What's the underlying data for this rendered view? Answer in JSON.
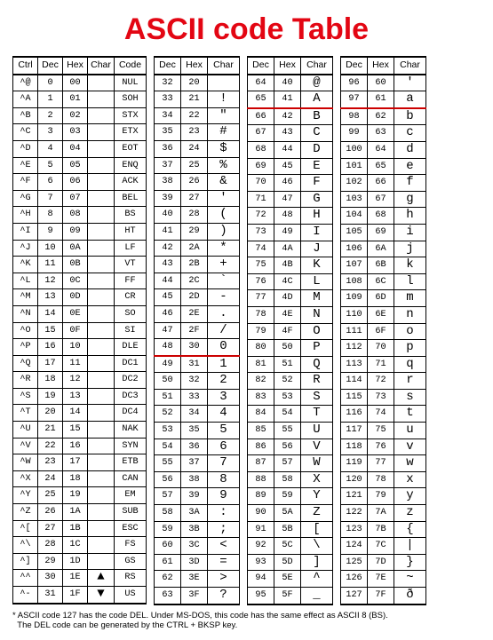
{
  "title": "ASCII code Table",
  "headers": {
    "ctrl": "Ctrl",
    "dec": "Dec",
    "hex": "Hex",
    "char": "Char",
    "code": "Code"
  },
  "panel1": [
    {
      "ctrl": "^@",
      "dec": 0,
      "hex": "00",
      "char": "",
      "code": "NUL"
    },
    {
      "ctrl": "^A",
      "dec": 1,
      "hex": "01",
      "char": "",
      "code": "SOH"
    },
    {
      "ctrl": "^B",
      "dec": 2,
      "hex": "02",
      "char": "",
      "code": "STX"
    },
    {
      "ctrl": "^C",
      "dec": 3,
      "hex": "03",
      "char": "",
      "code": "ETX"
    },
    {
      "ctrl": "^D",
      "dec": 4,
      "hex": "04",
      "char": "",
      "code": "EOT"
    },
    {
      "ctrl": "^E",
      "dec": 5,
      "hex": "05",
      "char": "",
      "code": "ENQ"
    },
    {
      "ctrl": "^F",
      "dec": 6,
      "hex": "06",
      "char": "",
      "code": "ACK"
    },
    {
      "ctrl": "^G",
      "dec": 7,
      "hex": "07",
      "char": "",
      "code": "BEL"
    },
    {
      "ctrl": "^H",
      "dec": 8,
      "hex": "08",
      "char": "",
      "code": "BS"
    },
    {
      "ctrl": "^I",
      "dec": 9,
      "hex": "09",
      "char": "",
      "code": "HT"
    },
    {
      "ctrl": "^J",
      "dec": 10,
      "hex": "0A",
      "char": "",
      "code": "LF"
    },
    {
      "ctrl": "^K",
      "dec": 11,
      "hex": "0B",
      "char": "",
      "code": "VT"
    },
    {
      "ctrl": "^L",
      "dec": 12,
      "hex": "0C",
      "char": "",
      "code": "FF"
    },
    {
      "ctrl": "^M",
      "dec": 13,
      "hex": "0D",
      "char": "",
      "code": "CR"
    },
    {
      "ctrl": "^N",
      "dec": 14,
      "hex": "0E",
      "char": "",
      "code": "SO"
    },
    {
      "ctrl": "^O",
      "dec": 15,
      "hex": "0F",
      "char": "",
      "code": "SI"
    },
    {
      "ctrl": "^P",
      "dec": 16,
      "hex": "10",
      "char": "",
      "code": "DLE"
    },
    {
      "ctrl": "^Q",
      "dec": 17,
      "hex": "11",
      "char": "",
      "code": "DC1"
    },
    {
      "ctrl": "^R",
      "dec": 18,
      "hex": "12",
      "char": "",
      "code": "DC2"
    },
    {
      "ctrl": "^S",
      "dec": 19,
      "hex": "13",
      "char": "",
      "code": "DC3"
    },
    {
      "ctrl": "^T",
      "dec": 20,
      "hex": "14",
      "char": "",
      "code": "DC4"
    },
    {
      "ctrl": "^U",
      "dec": 21,
      "hex": "15",
      "char": "",
      "code": "NAK"
    },
    {
      "ctrl": "^V",
      "dec": 22,
      "hex": "16",
      "char": "",
      "code": "SYN"
    },
    {
      "ctrl": "^W",
      "dec": 23,
      "hex": "17",
      "char": "",
      "code": "ETB"
    },
    {
      "ctrl": "^X",
      "dec": 24,
      "hex": "18",
      "char": "",
      "code": "CAN"
    },
    {
      "ctrl": "^Y",
      "dec": 25,
      "hex": "19",
      "char": "",
      "code": "EM"
    },
    {
      "ctrl": "^Z",
      "dec": 26,
      "hex": "1A",
      "char": "",
      "code": "SUB"
    },
    {
      "ctrl": "^[",
      "dec": 27,
      "hex": "1B",
      "char": "",
      "code": "ESC"
    },
    {
      "ctrl": "^\\",
      "dec": 28,
      "hex": "1C",
      "char": "",
      "code": "FS"
    },
    {
      "ctrl": "^]",
      "dec": 29,
      "hex": "1D",
      "char": "",
      "code": "GS"
    },
    {
      "ctrl": "^^",
      "dec": 30,
      "hex": "1E",
      "char": "glyph-up",
      "code": "RS"
    },
    {
      "ctrl": "^-",
      "dec": 31,
      "hex": "1F",
      "char": "glyph-down",
      "code": "US"
    }
  ],
  "panel2": [
    {
      "dec": 32,
      "hex": "20",
      "char": " "
    },
    {
      "dec": 33,
      "hex": "21",
      "char": "!"
    },
    {
      "dec": 34,
      "hex": "22",
      "char": "\""
    },
    {
      "dec": 35,
      "hex": "23",
      "char": "#"
    },
    {
      "dec": 36,
      "hex": "24",
      "char": "$"
    },
    {
      "dec": 37,
      "hex": "25",
      "char": "%"
    },
    {
      "dec": 38,
      "hex": "26",
      "char": "&"
    },
    {
      "dec": 39,
      "hex": "27",
      "char": "'"
    },
    {
      "dec": 40,
      "hex": "28",
      "char": "("
    },
    {
      "dec": 41,
      "hex": "29",
      "char": ")"
    },
    {
      "dec": 42,
      "hex": "2A",
      "char": "*"
    },
    {
      "dec": 43,
      "hex": "2B",
      "char": "+"
    },
    {
      "dec": 44,
      "hex": "2C",
      "char": "`"
    },
    {
      "dec": 45,
      "hex": "2D",
      "char": "-"
    },
    {
      "dec": 46,
      "hex": "2E",
      "char": "."
    },
    {
      "dec": 47,
      "hex": "2F",
      "char": "/"
    },
    {
      "dec": 48,
      "hex": "30",
      "char": "0"
    },
    {
      "dec": 49,
      "hex": "31",
      "char": "1",
      "sep": true
    },
    {
      "dec": 50,
      "hex": "32",
      "char": "2"
    },
    {
      "dec": 51,
      "hex": "33",
      "char": "3"
    },
    {
      "dec": 52,
      "hex": "34",
      "char": "4"
    },
    {
      "dec": 53,
      "hex": "35",
      "char": "5"
    },
    {
      "dec": 54,
      "hex": "36",
      "char": "6"
    },
    {
      "dec": 55,
      "hex": "37",
      "char": "7"
    },
    {
      "dec": 56,
      "hex": "38",
      "char": "8"
    },
    {
      "dec": 57,
      "hex": "39",
      "char": "9"
    },
    {
      "dec": 58,
      "hex": "3A",
      "char": ":"
    },
    {
      "dec": 59,
      "hex": "3B",
      "char": ";"
    },
    {
      "dec": 60,
      "hex": "3C",
      "char": "<"
    },
    {
      "dec": 61,
      "hex": "3D",
      "char": "="
    },
    {
      "dec": 62,
      "hex": "3E",
      "char": ">"
    },
    {
      "dec": 63,
      "hex": "3F",
      "char": "?"
    }
  ],
  "panel3": [
    {
      "dec": 64,
      "hex": "40",
      "char": "@"
    },
    {
      "dec": 65,
      "hex": "41",
      "char": "A"
    },
    {
      "dec": 66,
      "hex": "42",
      "char": "B",
      "sep": true
    },
    {
      "dec": 67,
      "hex": "43",
      "char": "C"
    },
    {
      "dec": 68,
      "hex": "44",
      "char": "D"
    },
    {
      "dec": 69,
      "hex": "45",
      "char": "E"
    },
    {
      "dec": 70,
      "hex": "46",
      "char": "F"
    },
    {
      "dec": 71,
      "hex": "47",
      "char": "G"
    },
    {
      "dec": 72,
      "hex": "48",
      "char": "H"
    },
    {
      "dec": 73,
      "hex": "49",
      "char": "I"
    },
    {
      "dec": 74,
      "hex": "4A",
      "char": "J"
    },
    {
      "dec": 75,
      "hex": "4B",
      "char": "K"
    },
    {
      "dec": 76,
      "hex": "4C",
      "char": "L"
    },
    {
      "dec": 77,
      "hex": "4D",
      "char": "M"
    },
    {
      "dec": 78,
      "hex": "4E",
      "char": "N"
    },
    {
      "dec": 79,
      "hex": "4F",
      "char": "O"
    },
    {
      "dec": 80,
      "hex": "50",
      "char": "P"
    },
    {
      "dec": 81,
      "hex": "51",
      "char": "Q"
    },
    {
      "dec": 82,
      "hex": "52",
      "char": "R"
    },
    {
      "dec": 83,
      "hex": "53",
      "char": "S"
    },
    {
      "dec": 84,
      "hex": "54",
      "char": "T"
    },
    {
      "dec": 85,
      "hex": "55",
      "char": "U"
    },
    {
      "dec": 86,
      "hex": "56",
      "char": "V"
    },
    {
      "dec": 87,
      "hex": "57",
      "char": "W"
    },
    {
      "dec": 88,
      "hex": "58",
      "char": "X"
    },
    {
      "dec": 89,
      "hex": "59",
      "char": "Y"
    },
    {
      "dec": 90,
      "hex": "5A",
      "char": "Z"
    },
    {
      "dec": 91,
      "hex": "5B",
      "char": "["
    },
    {
      "dec": 92,
      "hex": "5C",
      "char": "\\"
    },
    {
      "dec": 93,
      "hex": "5D",
      "char": "]"
    },
    {
      "dec": 94,
      "hex": "5E",
      "char": "^"
    },
    {
      "dec": 95,
      "hex": "5F",
      "char": "_"
    }
  ],
  "panel4": [
    {
      "dec": 96,
      "hex": "60",
      "char": "'"
    },
    {
      "dec": 97,
      "hex": "61",
      "char": "a"
    },
    {
      "dec": 98,
      "hex": "62",
      "char": "b",
      "sep": true
    },
    {
      "dec": 99,
      "hex": "63",
      "char": "c"
    },
    {
      "dec": 100,
      "hex": "64",
      "char": "d"
    },
    {
      "dec": 101,
      "hex": "65",
      "char": "e"
    },
    {
      "dec": 102,
      "hex": "66",
      "char": "f"
    },
    {
      "dec": 103,
      "hex": "67",
      "char": "g"
    },
    {
      "dec": 104,
      "hex": "68",
      "char": "h"
    },
    {
      "dec": 105,
      "hex": "69",
      "char": "i"
    },
    {
      "dec": 106,
      "hex": "6A",
      "char": "j"
    },
    {
      "dec": 107,
      "hex": "6B",
      "char": "k"
    },
    {
      "dec": 108,
      "hex": "6C",
      "char": "l"
    },
    {
      "dec": 109,
      "hex": "6D",
      "char": "m"
    },
    {
      "dec": 110,
      "hex": "6E",
      "char": "n"
    },
    {
      "dec": 111,
      "hex": "6F",
      "char": "o"
    },
    {
      "dec": 112,
      "hex": "70",
      "char": "p"
    },
    {
      "dec": 113,
      "hex": "71",
      "char": "q"
    },
    {
      "dec": 114,
      "hex": "72",
      "char": "r"
    },
    {
      "dec": 115,
      "hex": "73",
      "char": "s"
    },
    {
      "dec": 116,
      "hex": "74",
      "char": "t"
    },
    {
      "dec": 117,
      "hex": "75",
      "char": "u"
    },
    {
      "dec": 118,
      "hex": "76",
      "char": "v"
    },
    {
      "dec": 119,
      "hex": "77",
      "char": "w"
    },
    {
      "dec": 120,
      "hex": "78",
      "char": "x"
    },
    {
      "dec": 121,
      "hex": "79",
      "char": "y"
    },
    {
      "dec": 122,
      "hex": "7A",
      "char": "z"
    },
    {
      "dec": 123,
      "hex": "7B",
      "char": "{"
    },
    {
      "dec": 124,
      "hex": "7C",
      "char": "|"
    },
    {
      "dec": 125,
      "hex": "7D",
      "char": "}"
    },
    {
      "dec": 126,
      "hex": "7E",
      "char": "~"
    },
    {
      "dec": 127,
      "hex": "7F",
      "char": "ð"
    }
  ],
  "note_line1": "* ASCII code 127 has the code DEL. Under MS-DOS, this code has the same effect as ASCII 8 (BS).",
  "note_line2": "The DEL code can be generated by the CTRL + BKSP key."
}
